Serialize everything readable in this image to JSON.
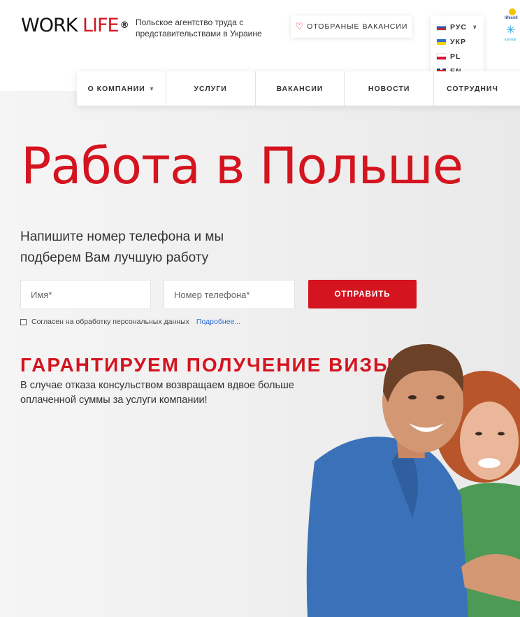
{
  "header": {
    "logo_work": "WORK",
    "logo_life": "LIFE",
    "logo_reg": "®",
    "tagline": "Польское агентство труда с представительствами в Украине",
    "favorites_label": "ОТОБРАНЫЕ ВАКАНСИИ",
    "operators": [
      "lifecell",
      "kyivstar"
    ]
  },
  "languages": [
    {
      "code": "РУС",
      "flag": "ru",
      "selected": true
    },
    {
      "code": "УКР",
      "flag": "ua"
    },
    {
      "code": "PL",
      "flag": "pl"
    },
    {
      "code": "EN",
      "flag": "en"
    }
  ],
  "nav": {
    "items": [
      {
        "label": "О КОМПАНИИ",
        "has_dropdown": true
      },
      {
        "label": "УСЛУГИ"
      },
      {
        "label": "ВАКАНСИИ"
      },
      {
        "label": "НОВОСТИ"
      },
      {
        "label": "СОТРУДНИЧ"
      }
    ]
  },
  "hero": {
    "title": "Работа в Польше",
    "subtitle": "Напишите номер телефона и мы подберем Вам лучшую работу",
    "name_placeholder": "Имя*",
    "phone_placeholder": "Номер телефона*",
    "submit_label": "ОТПРАВИТЬ",
    "consent_text": "Согласен на обработку персональных данных",
    "consent_link": "Подробнее...",
    "visa_title": "ГАРАНТИРУЕМ ПОЛУЧЕНИЕ ВИЗЫ!",
    "visa_text": "В случае отказа консульством возвращаем вдвое больше оплаченной суммы за услуги компании!"
  },
  "colors": {
    "brand_red": "#d4141f",
    "link_blue": "#2c6bd6"
  },
  "icons": [
    "heart-icon",
    "chevron-down-icon",
    "flag-ru-icon",
    "flag-ua-icon",
    "flag-pl-icon",
    "flag-en-icon",
    "lifecell-logo",
    "kyivstar-logo"
  ]
}
